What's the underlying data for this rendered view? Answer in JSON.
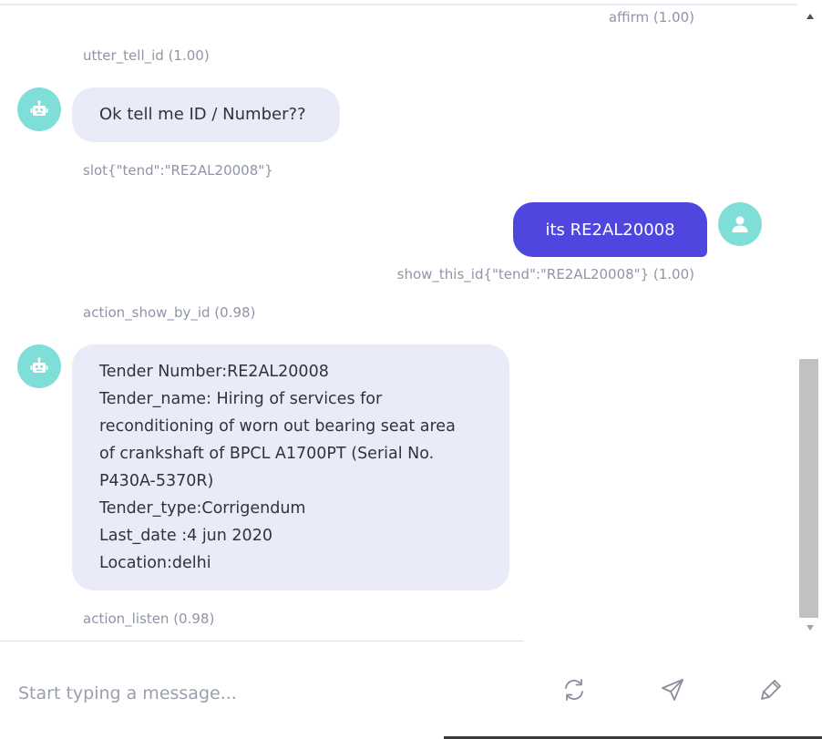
{
  "conversation": {
    "meta_affirm": "affirm (1.00)",
    "meta_utter_tell_id": "utter_tell_id (1.00)",
    "bot_msg_1": "Ok tell me ID / Number??",
    "meta_slot": "slot{\"tend\":\"RE2AL20008\"}",
    "user_msg_1": "its RE2AL20008",
    "meta_show_this_id": "show_this_id{\"tend\":\"RE2AL20008\"} (1.00)",
    "meta_action_show_by_id": "action_show_by_id (0.98)",
    "tender_lines": [
      "Tender Number:RE2AL20008",
      "Tender_name: Hiring of services for",
      "reconditioning of worn out bearing seat area",
      "of crankshaft of BPCL A1700PT (Serial No.",
      "P430A-5370R)",
      "Tender_type:Corrigendum",
      "Last_date :4 jun 2020",
      "Location:delhi"
    ],
    "meta_action_listen": "action_listen (0.98)"
  },
  "input": {
    "placeholder": "Start typing a message..."
  },
  "icons": {
    "bot_avatar": "robot-icon",
    "user_avatar": "user-icon",
    "restart": "refresh-icon",
    "send": "send-icon",
    "edit": "pen-icon",
    "scroll_up": "triangle-up-icon",
    "scroll_down": "triangle-down-icon"
  },
  "colors": {
    "avatar": "#7fded8",
    "bot_bubble": "#e9ecf8",
    "user_bubble": "#4f46e0",
    "meta_text": "#8f95a8"
  }
}
